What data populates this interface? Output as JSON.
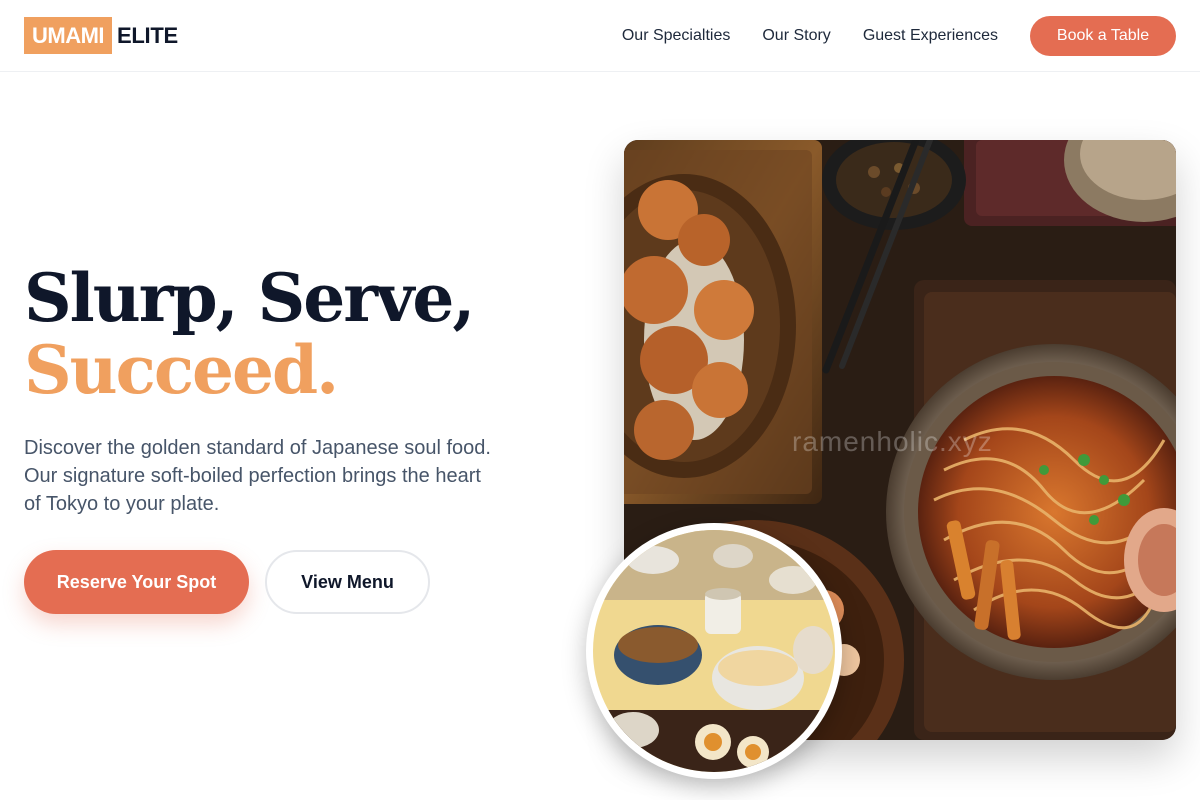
{
  "brand": {
    "logo_box": "UMAMI",
    "logo_word": "ELITE"
  },
  "nav": {
    "links": [
      "Our Specialties",
      "Our Story",
      "Guest Experiences"
    ],
    "cta": "Book a Table"
  },
  "hero": {
    "headline_line1": "Slurp, Serve,",
    "headline_line2": "Succeed.",
    "description": "Discover the golden standard of Japanese soul food. Our signature soft-boiled perfection brings the heart of Tokyo to your plate.",
    "primary_button": "Reserve Your Spot",
    "secondary_button": "View Menu",
    "watermark": "ramenholic.xyz"
  },
  "colors": {
    "accent": "#e46d52",
    "gold": "#f0a05f",
    "heading": "#0f172a",
    "body": "#475569"
  }
}
